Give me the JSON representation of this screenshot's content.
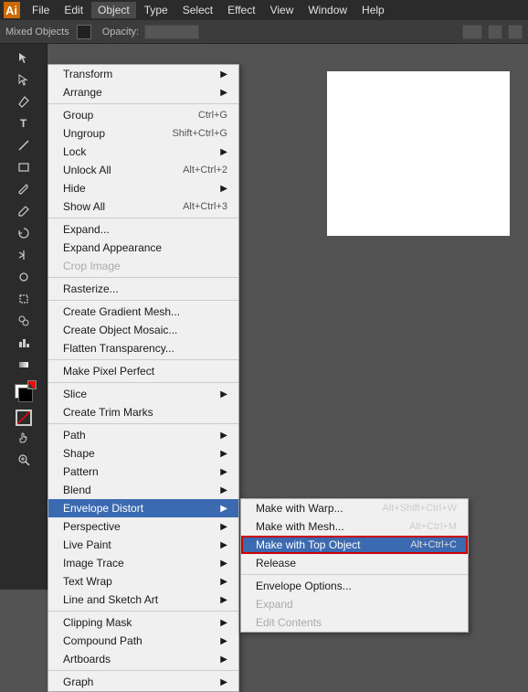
{
  "app": {
    "title": "Adobe Illustrator",
    "logo": "Ai"
  },
  "menubar": {
    "items": [
      "File",
      "Edit",
      "Object",
      "Type",
      "Select",
      "Effect",
      "View",
      "Window",
      "Help"
    ]
  },
  "toolbar": {
    "label": "Mixed Objects",
    "opacity_label": "Opacity:",
    "opacity_value": ""
  },
  "object_menu": {
    "items": [
      {
        "label": "Transform",
        "shortcut": "",
        "has_arrow": true
      },
      {
        "label": "Arrange",
        "shortcut": "",
        "has_arrow": true
      },
      {
        "label": "separator1"
      },
      {
        "label": "Group",
        "shortcut": "Ctrl+G",
        "has_arrow": false
      },
      {
        "label": "Ungroup",
        "shortcut": "Shift+Ctrl+G",
        "has_arrow": false
      },
      {
        "label": "Lock",
        "shortcut": "",
        "has_arrow": true
      },
      {
        "label": "Unlock All",
        "shortcut": "Alt+Ctrl+2",
        "has_arrow": false
      },
      {
        "label": "Hide",
        "shortcut": "",
        "has_arrow": true
      },
      {
        "label": "Show All",
        "shortcut": "Alt+Ctrl+3",
        "has_arrow": false
      },
      {
        "label": "separator2"
      },
      {
        "label": "Expand...",
        "shortcut": "",
        "has_arrow": false
      },
      {
        "label": "Expand Appearance",
        "shortcut": "",
        "has_arrow": false
      },
      {
        "label": "Crop Image",
        "shortcut": "",
        "has_arrow": false,
        "disabled": true
      },
      {
        "label": "separator3"
      },
      {
        "label": "Rasterize...",
        "shortcut": "",
        "has_arrow": false
      },
      {
        "label": "separator4"
      },
      {
        "label": "Create Gradient Mesh...",
        "shortcut": "",
        "has_arrow": false
      },
      {
        "label": "Create Object Mosaic...",
        "shortcut": "",
        "has_arrow": false
      },
      {
        "label": "Flatten Transparency...",
        "shortcut": "",
        "has_arrow": false
      },
      {
        "label": "separator5"
      },
      {
        "label": "Make Pixel Perfect",
        "shortcut": "",
        "has_arrow": false
      },
      {
        "label": "separator6"
      },
      {
        "label": "Slice",
        "shortcut": "",
        "has_arrow": true
      },
      {
        "label": "Create Trim Marks",
        "shortcut": "",
        "has_arrow": false
      },
      {
        "label": "separator7"
      },
      {
        "label": "Path",
        "shortcut": "",
        "has_arrow": true
      },
      {
        "label": "Shape",
        "shortcut": "",
        "has_arrow": true
      },
      {
        "label": "Pattern",
        "shortcut": "",
        "has_arrow": true
      },
      {
        "label": "Blend",
        "shortcut": "",
        "has_arrow": true
      },
      {
        "label": "Envelope Distort",
        "shortcut": "",
        "has_arrow": true,
        "highlighted": true
      },
      {
        "label": "Perspective",
        "shortcut": "",
        "has_arrow": true
      },
      {
        "label": "Live Paint",
        "shortcut": "",
        "has_arrow": true
      },
      {
        "label": "Image Trace",
        "shortcut": "",
        "has_arrow": true
      },
      {
        "label": "Text Wrap",
        "shortcut": "",
        "has_arrow": true
      },
      {
        "label": "Line and Sketch Art",
        "shortcut": "",
        "has_arrow": true
      },
      {
        "label": "separator8"
      },
      {
        "label": "Clipping Mask",
        "shortcut": "",
        "has_arrow": true
      },
      {
        "label": "Compound Path",
        "shortcut": "",
        "has_arrow": true
      },
      {
        "label": "Artboards",
        "shortcut": "",
        "has_arrow": true
      },
      {
        "label": "separator9"
      },
      {
        "label": "Graph",
        "shortcut": "",
        "has_arrow": true
      }
    ]
  },
  "envelope_submenu": {
    "items": [
      {
        "label": "Make with Warp...",
        "shortcut": "Alt+Shift+Ctrl+W",
        "active": false,
        "disabled": false
      },
      {
        "label": "Make with Mesh...",
        "shortcut": "Alt+Ctrl+M",
        "active": false,
        "disabled": false
      },
      {
        "label": "Make with Top Object",
        "shortcut": "Alt+Ctrl+C",
        "active": true,
        "disabled": false
      },
      {
        "label": "Release",
        "shortcut": "",
        "active": false,
        "disabled": false
      },
      {
        "label": "separator"
      },
      {
        "label": "Envelope Options...",
        "shortcut": "",
        "active": false,
        "disabled": false
      },
      {
        "label": "Expand",
        "shortcut": "",
        "active": false,
        "disabled": true
      },
      {
        "label": "Edit Contents",
        "shortcut": "",
        "active": false,
        "disabled": true
      }
    ]
  },
  "sidebar_tools": [
    "▶",
    "✥",
    "P",
    "✎",
    "T",
    "⬡",
    "⬭",
    "✏",
    "⬜",
    "☁",
    "✂",
    "⟳",
    "⊕",
    "☰",
    "◈",
    "⬛",
    "⬛",
    "□",
    "✋",
    "🔍"
  ]
}
